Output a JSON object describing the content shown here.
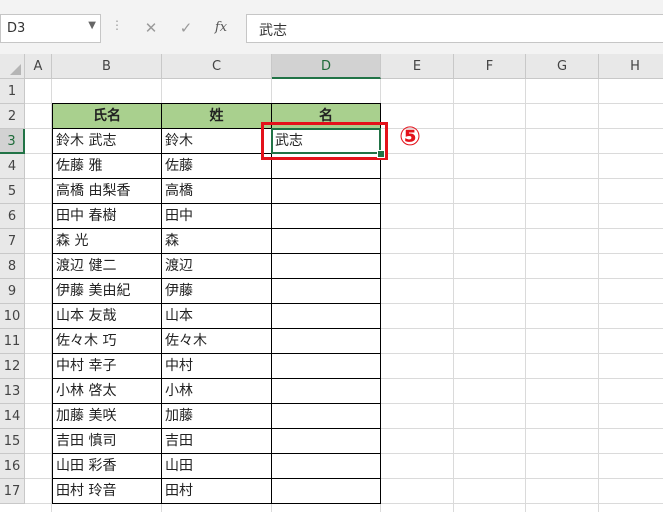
{
  "formula_bar": {
    "name_box": "D3",
    "name_box_dropdown_icon": "chevron-down-icon",
    "separator": "⋮",
    "cancel_symbol": "✕",
    "enter_symbol": "✓",
    "fx_label": "fx",
    "formula_value": "武志"
  },
  "columns": [
    "A",
    "B",
    "C",
    "D",
    "E",
    "F",
    "G",
    "H"
  ],
  "selected_column": "D",
  "rows": [
    "1",
    "2",
    "3",
    "4",
    "5",
    "6",
    "7",
    "8",
    "9",
    "10",
    "11",
    "12",
    "13",
    "14",
    "15",
    "16",
    "17"
  ],
  "selected_row": "3",
  "table": {
    "headers": [
      "氏名",
      "姓",
      "名"
    ],
    "data": [
      [
        "鈴木 武志",
        "鈴木",
        "武志"
      ],
      [
        "佐藤 雅",
        "佐藤",
        ""
      ],
      [
        "高橋 由梨香",
        "高橋",
        ""
      ],
      [
        "田中 春樹",
        "田中",
        ""
      ],
      [
        "森 光",
        "森",
        ""
      ],
      [
        "渡辺 健二",
        "渡辺",
        ""
      ],
      [
        "伊藤 美由紀",
        "伊藤",
        ""
      ],
      [
        "山本 友哉",
        "山本",
        ""
      ],
      [
        "佐々木 巧",
        "佐々木",
        ""
      ],
      [
        "中村 幸子",
        "中村",
        ""
      ],
      [
        "小林 啓太",
        "小林",
        ""
      ],
      [
        "加藤 美咲",
        "加藤",
        ""
      ],
      [
        "吉田 慎司",
        "吉田",
        ""
      ],
      [
        "山田 彩香",
        "山田",
        ""
      ],
      [
        "田村 玲音",
        "田村",
        ""
      ]
    ],
    "header_color": "#a9d08e"
  },
  "step_marker": "⑤",
  "colors": {
    "accent": "#217346",
    "highlight_red": "#e3121b"
  }
}
